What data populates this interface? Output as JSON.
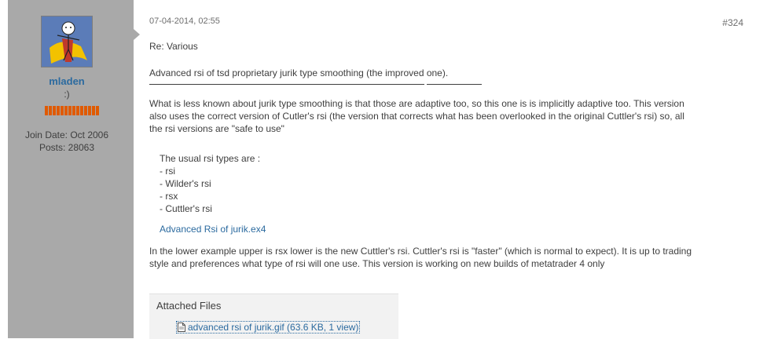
{
  "user": {
    "name": "mladen",
    "title": ":)",
    "join_date": "Join Date: Oct 2006",
    "posts": "Posts: 28063",
    "reputation_pips": 14,
    "reputation_color": "#e05a00"
  },
  "post": {
    "date": "07-04-2014, 02:55",
    "number": "#324",
    "title": "Re: Various",
    "line1": "Advanced rsi of tsd proprietary jurik type smoothing (the improved one).",
    "para1_l1": "What is less known about jurik type smoothing is that those are adaptive too, so this one is is implicitly adaptive too. This version",
    "para1_l2": "also uses the correct version of Cutler's rsi (the version that corrects what has been overlooked in the original Cuttler's rsi) so, all",
    "para1_l3": "the rsi versions are \"safe to use\"",
    "list_intro": "The usual rsi types are :",
    "list_items": [
      "- rsi",
      "- Wilder's rsi",
      "- rsx",
      "- Cuttler's rsi"
    ],
    "attachment_link": "Advanced Rsi of jurik.ex4",
    "para2_l1": "In the lower example upper is rsx lower is the new Cuttler's rsi. Cuttler's rsi is \"faster\" (which is normal to expect). It is up to trading",
    "para2_l2": "style and preferences what type of rsi will one use. This version is working on new builds of metatrader 4 only"
  },
  "attached_files": {
    "header": "Attached Files",
    "file_label": "advanced rsi of jurik.gif (63.6 KB, 1 view)",
    "file_icon": "image-file-icon"
  },
  "colors": {
    "link": "#2b6a9f",
    "sidebar": "#a9a9a9"
  }
}
